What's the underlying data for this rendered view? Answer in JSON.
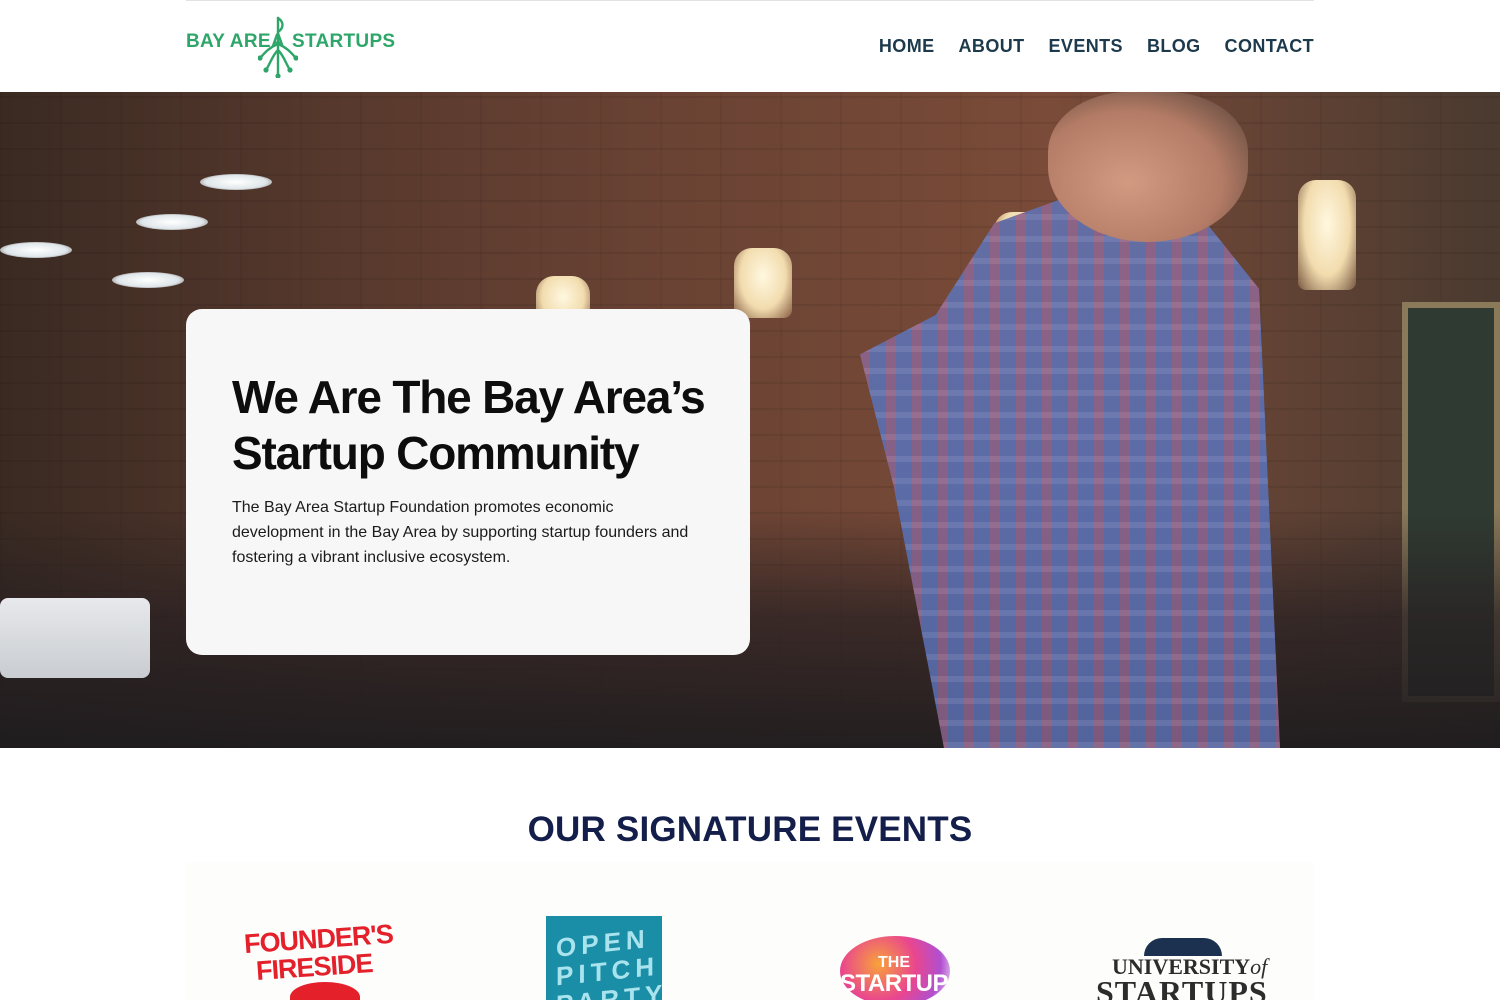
{
  "header": {
    "logo": {
      "left_text": "BAY AREA",
      "right_text": "STARTUPS",
      "color": "#2ea66a"
    },
    "nav": [
      "HOME",
      "ABOUT",
      "EVENTS",
      "BLOG",
      "CONTACT"
    ]
  },
  "hero": {
    "title": "We Are The Bay Area’s Startup Community",
    "description": "The Bay Area Startup Foundation promotes economic development in the Bay Area by supporting startup founders and fostering a vibrant inclusive ecosystem."
  },
  "events_section": {
    "title": "OUR SIGNATURE EVENTS",
    "events": [
      {
        "logo_line1": "FOUNDER'S",
        "logo_line2": "FIRESIDE",
        "color": "#e4202b"
      },
      {
        "logo_line1": "OPEN",
        "logo_line2": "PITCH",
        "logo_line3": "PARTY",
        "color": "#1a8ea6"
      },
      {
        "logo_line1": "THE",
        "logo_line2": "STARTUP",
        "color": "#e9468e"
      },
      {
        "logo_line1_main": "UNIVERSITY",
        "logo_line1_of": "of",
        "logo_line2": "STARTUPS",
        "color": "#1c3150"
      }
    ]
  }
}
